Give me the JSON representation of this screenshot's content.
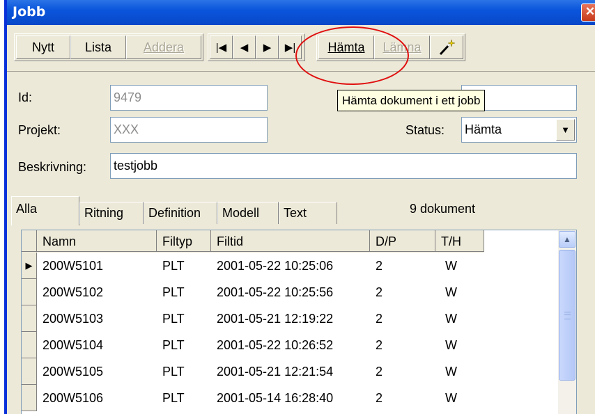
{
  "window": {
    "title": "Jobb",
    "close_glyph": "✕"
  },
  "toolbar": {
    "new": "Nytt",
    "list": "Lista",
    "add": "Addera",
    "first_glyph": "|◀",
    "prev_glyph": "◀",
    "next_glyph": "▶",
    "last_glyph": "▶|",
    "fetch": "Hämta",
    "submit": "Lämna",
    "wizard_icon": "magic-wand-icon"
  },
  "tooltip": "Hämta dokument i ett jobb",
  "fields": {
    "id_label": "Id:",
    "id_value": "9479",
    "project_label": "Projekt:",
    "project_value": "XXX",
    "status_label": "Status:",
    "status_value": "Hämta",
    "description_label": "Beskrivning:",
    "description_value": "testjobb"
  },
  "tabs": [
    "Alla",
    "Ritning",
    "Definition",
    "Modell",
    "Text"
  ],
  "document_count": "9 dokument",
  "grid": {
    "columns": [
      "Namn",
      "Filtyp",
      "Filtid",
      "D/P",
      "T/H"
    ],
    "rows": [
      [
        "200W5101",
        "PLT",
        "2001-05-22 10:25:06",
        "2",
        "W"
      ],
      [
        "200W5102",
        "PLT",
        "2001-05-22 10:25:56",
        "2",
        "W"
      ],
      [
        "200W5103",
        "PLT",
        "2001-05-21 12:19:22",
        "2",
        "W"
      ],
      [
        "200W5104",
        "PLT",
        "2001-05-22 10:26:52",
        "2",
        "W"
      ],
      [
        "200W5105",
        "PLT",
        "2001-05-21 12:21:54",
        "2",
        "W"
      ],
      [
        "200W5106",
        "PLT",
        "2001-05-14 16:28:40",
        "2",
        "W"
      ]
    ],
    "current_row_glyph": "▶"
  },
  "colors": {
    "title_bar": "#0a55dc",
    "highlight_ellipse": "#e01010",
    "tooltip_bg": "#ffffe1"
  }
}
